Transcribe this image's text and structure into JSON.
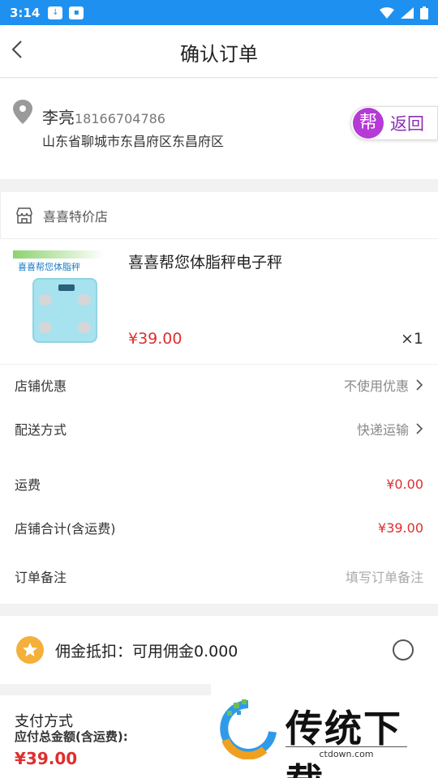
{
  "status_bar": {
    "time": "3:14"
  },
  "nav": {
    "title": "确认订单"
  },
  "address": {
    "name": "李亮",
    "phone": "18166704786",
    "full": "山东省聊城市东昌府区东昌府区"
  },
  "help_button": {
    "badge": "帮",
    "label": "返回"
  },
  "store": {
    "name": "喜喜特价店"
  },
  "product": {
    "image_label": "喜喜帮您体脂秤",
    "name": "喜喜帮您体脂秤电子秤",
    "price": "¥39.00",
    "quantity": "×1"
  },
  "rows": {
    "discount_label": "店铺优惠",
    "discount_value": "不使用优惠",
    "shipping_label": "配送方式",
    "shipping_value": "快递运输",
    "freight_label": "运费",
    "freight_value": "¥0.00",
    "subtotal_label": "店铺合计(含运费)",
    "subtotal_value": "¥39.00",
    "note_label": "订单备注",
    "note_placeholder": "填写订单备注"
  },
  "commission": {
    "label": "佣金抵扣：可用佣金0.000"
  },
  "payment": {
    "title": "支付方式",
    "total_label": "应付总金额(含运费):",
    "total_value": "¥39.00"
  },
  "watermark": {
    "text": "传统下载",
    "url": "ctdown.com"
  }
}
